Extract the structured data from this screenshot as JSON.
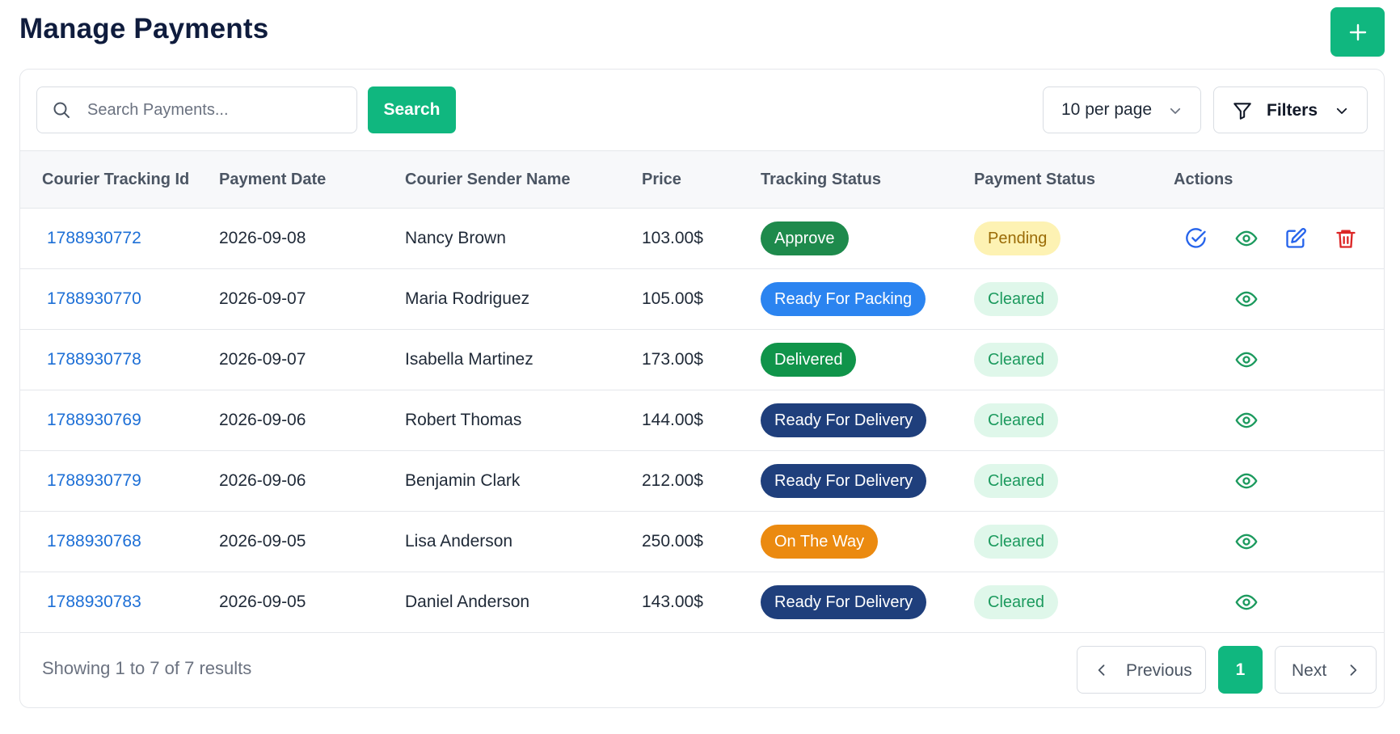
{
  "page": {
    "title": "Manage Payments",
    "add_icon": "plus-icon"
  },
  "toolbar": {
    "search_placeholder": "Search Payments...",
    "search_label": "Search",
    "per_page_label": "10 per page",
    "filters_label": "Filters"
  },
  "table": {
    "columns": [
      "Courier Tracking Id",
      "Payment Date",
      "Courier Sender Name",
      "Price",
      "Tracking Status",
      "Payment Status",
      "Actions"
    ],
    "rows": [
      {
        "id": "1788930772",
        "date": "2026-09-08",
        "sender": "Nancy Brown",
        "price": "103.00$",
        "tracking_status": "Approve",
        "payment_status": "Pending",
        "actions": [
          "approve",
          "view",
          "edit",
          "delete"
        ]
      },
      {
        "id": "1788930770",
        "date": "2026-09-07",
        "sender": "Maria Rodriguez",
        "price": "105.00$",
        "tracking_status": "Ready For Packing",
        "payment_status": "Cleared",
        "actions": [
          "view"
        ]
      },
      {
        "id": "1788930778",
        "date": "2026-09-07",
        "sender": "Isabella Martinez",
        "price": "173.00$",
        "tracking_status": "Delivered",
        "payment_status": "Cleared",
        "actions": [
          "view"
        ]
      },
      {
        "id": "1788930769",
        "date": "2026-09-06",
        "sender": "Robert Thomas",
        "price": "144.00$",
        "tracking_status": "Ready For Delivery",
        "payment_status": "Cleared",
        "actions": [
          "view"
        ]
      },
      {
        "id": "1788930779",
        "date": "2026-09-06",
        "sender": "Benjamin Clark",
        "price": "212.00$",
        "tracking_status": "Ready For Delivery",
        "payment_status": "Cleared",
        "actions": [
          "view"
        ]
      },
      {
        "id": "1788930768",
        "date": "2026-09-05",
        "sender": "Lisa Anderson",
        "price": "250.00$",
        "tracking_status": "On The Way",
        "payment_status": "Cleared",
        "actions": [
          "view"
        ]
      },
      {
        "id": "1788930783",
        "date": "2026-09-05",
        "sender": "Daniel Anderson",
        "price": "143.00$",
        "tracking_status": "Ready For Delivery",
        "payment_status": "Cleared",
        "actions": [
          "view"
        ]
      }
    ]
  },
  "footer": {
    "showing_text": "Showing 1 to 7 of 7 results",
    "previous_label": "Previous",
    "current_page": "1",
    "next_label": "Next"
  },
  "colors": {
    "brand": "#10b77f",
    "link": "#1d6fd6",
    "approve": "#1e8a4c",
    "ready_for_packing": "#2b84f0",
    "delivered": "#10944a",
    "ready_for_delivery": "#1f3f7c",
    "on_the_way": "#eb8a10",
    "pending_bg": "#fdf2b3",
    "cleared_bg": "#dff7ea",
    "delete": "#dc2626"
  }
}
